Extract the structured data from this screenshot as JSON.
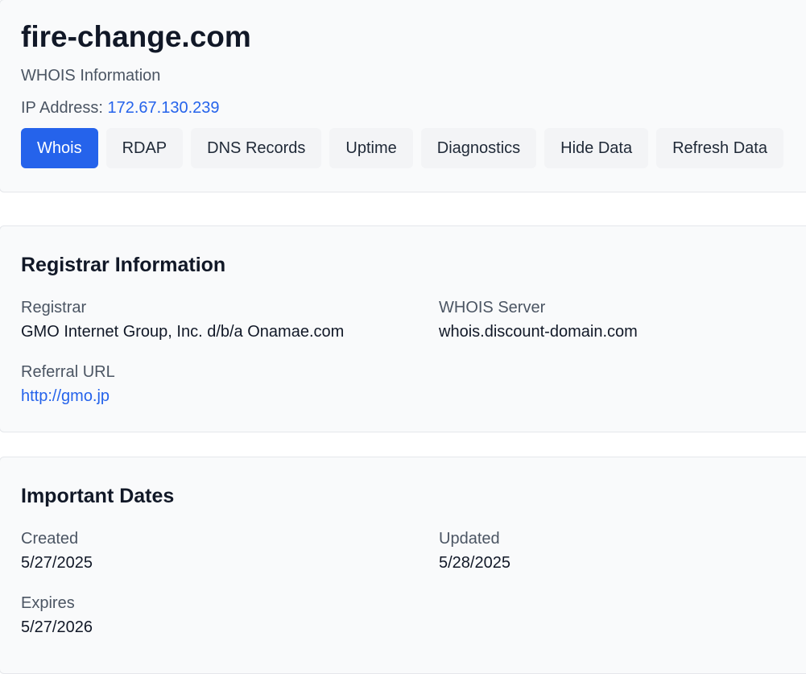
{
  "header": {
    "domain": "fire-change.com",
    "subtitle": "WHOIS Information",
    "ip_label": "IP Address:",
    "ip_value": "172.67.130.239"
  },
  "tabs": [
    {
      "label": "Whois",
      "active": true
    },
    {
      "label": "RDAP",
      "active": false
    },
    {
      "label": "DNS Records",
      "active": false
    },
    {
      "label": "Uptime",
      "active": false
    },
    {
      "label": "Diagnostics",
      "active": false
    },
    {
      "label": "Hide Data",
      "active": false
    },
    {
      "label": "Refresh Data",
      "active": false
    }
  ],
  "registrar": {
    "title": "Registrar Information",
    "registrar_label": "Registrar",
    "registrar_value": "GMO Internet Group, Inc. d/b/a Onamae.com",
    "whois_server_label": "WHOIS Server",
    "whois_server_value": "whois.discount-domain.com",
    "referral_label": "Referral URL",
    "referral_value": "http://gmo.jp"
  },
  "dates": {
    "title": "Important Dates",
    "created_label": "Created",
    "created_value": "5/27/2025",
    "updated_label": "Updated",
    "updated_value": "5/28/2025",
    "expires_label": "Expires",
    "expires_value": "5/27/2026"
  },
  "colors": {
    "accent": "#2563eb",
    "card_bg": "#f9fafb",
    "tab_bg": "#f3f4f6",
    "muted_text": "#4b5563"
  }
}
